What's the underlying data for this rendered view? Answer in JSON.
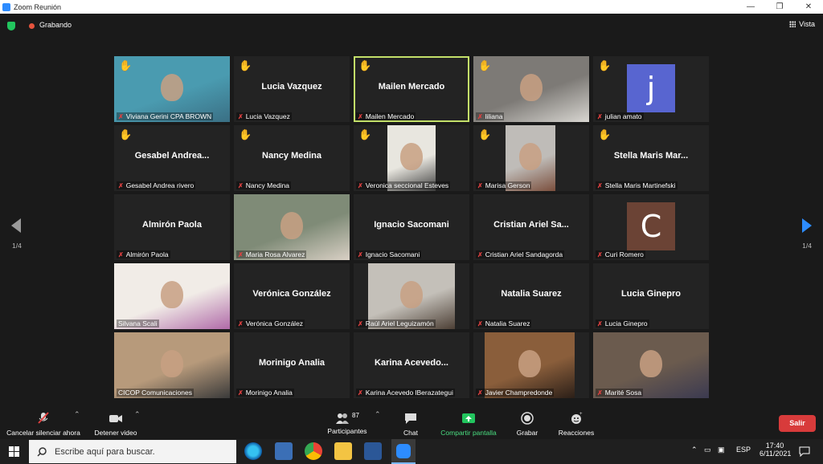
{
  "window": {
    "title": "Zoom Reunión",
    "minimize": "—",
    "maximize": "❐",
    "close": "✕"
  },
  "status": {
    "recording_label": "Grabando",
    "view_label": "Vista"
  },
  "pagination": {
    "left": "1/4",
    "right": "1/4"
  },
  "tiles": [
    {
      "label": "Viviana Gerini CPA BROWN",
      "hand": true,
      "type": "video",
      "active": false
    },
    {
      "label": "Lucia Vazquez",
      "bigname": "Lucia Vazquez",
      "hand": true,
      "type": "name",
      "active": false
    },
    {
      "label": "Mailen Mercado",
      "bigname": "Mailen Mercado",
      "hand": true,
      "type": "name",
      "active": true
    },
    {
      "label": "liliana",
      "hand": true,
      "type": "video",
      "active": false
    },
    {
      "label": "julian amato",
      "hand": true,
      "type": "avatar",
      "letter": "j",
      "avatar_color": "#5865d0",
      "active": false
    },
    {
      "label": "Gesabel Andrea rivero",
      "bigname": "Gesabel Andrea...",
      "hand": true,
      "type": "name",
      "active": false
    },
    {
      "label": "Nancy Medina",
      "bigname": "Nancy Medina",
      "hand": true,
      "type": "name",
      "active": false
    },
    {
      "label": "Veronica seccional Esteves",
      "hand": true,
      "type": "video",
      "active": false
    },
    {
      "label": "Marisa Gerson",
      "hand": true,
      "type": "video",
      "active": false
    },
    {
      "label": "Stella Maris Martinefski",
      "bigname": "Stella Maris Mar...",
      "hand": true,
      "type": "name",
      "active": false
    },
    {
      "label": "Almirón Paola",
      "bigname": "Almirón Paola",
      "hand": false,
      "type": "name",
      "active": false
    },
    {
      "label": "Maria Rosa Alvarez",
      "hand": false,
      "type": "video",
      "active": false
    },
    {
      "label": "Ignacio Sacomani",
      "bigname": "Ignacio Sacomani",
      "hand": false,
      "type": "name",
      "active": false
    },
    {
      "label": "Cristian Ariel Sandagorda",
      "bigname": "Cristian Ariel Sa...",
      "hand": false,
      "type": "name",
      "active": false
    },
    {
      "label": "Curi Romero",
      "hand": false,
      "type": "avatar",
      "letter": "C",
      "avatar_color": "#6b4335",
      "active": false
    },
    {
      "label": "Silvana Scali",
      "hand": false,
      "type": "video",
      "active": false,
      "unmuted": true
    },
    {
      "label": "Verónica González",
      "bigname": "Verónica González",
      "hand": false,
      "type": "name",
      "active": false
    },
    {
      "label": "Raúl Ariel Leguizamón",
      "hand": false,
      "type": "video",
      "active": false
    },
    {
      "label": "Natalia Suarez",
      "bigname": "Natalia Suarez",
      "hand": false,
      "type": "name",
      "active": false
    },
    {
      "label": "Lucia Ginepro",
      "bigname": "Lucia Ginepro",
      "hand": false,
      "type": "name",
      "active": false
    },
    {
      "label": "CICOP Comunicaciones",
      "hand": false,
      "type": "video",
      "active": false,
      "unmuted": true
    },
    {
      "label": "Morinigo Analia",
      "bigname": "Morinigo Analia",
      "hand": false,
      "type": "name",
      "active": false
    },
    {
      "label": "Karina Acevedo lBerazategui",
      "bigname": "Karina  Acevedo...",
      "hand": false,
      "type": "name",
      "active": false
    },
    {
      "label": "Javier Champredonde",
      "hand": false,
      "type": "video",
      "active": false
    },
    {
      "label": "Marité Sosa",
      "hand": false,
      "type": "video",
      "active": false
    }
  ],
  "toolbar": {
    "unmute_label": "Cancelar silenciar ahora",
    "video_label": "Detener video",
    "participants_label": "Participantes",
    "participants_count": "87",
    "chat_label": "Chat",
    "share_label": "Compartir pantalla",
    "record_label": "Grabar",
    "reactions_label": "Reacciones",
    "leave_label": "Salir"
  },
  "taskbar": {
    "search_placeholder": "Escribe aquí para buscar.",
    "lang": "ESP",
    "time": "17:40",
    "date": "6/11/2021"
  },
  "colors": {
    "active_speaker": "#c3e069",
    "accent": "#2d8cff",
    "leave": "#d83b3b",
    "share": "#22c55e"
  }
}
